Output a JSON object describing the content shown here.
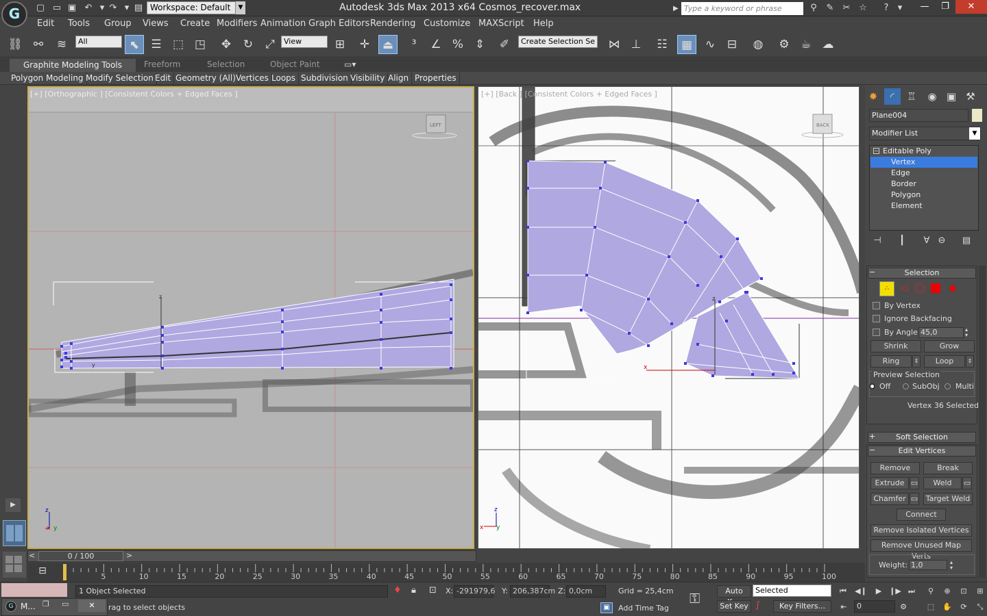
{
  "titlebar": {
    "app_title": "Autodesk 3ds Max  2013 x64     Cosmos_recover.max",
    "workspace": "Workspace: Default",
    "search_placeholder": "Type a keyword or phrase",
    "app_icon": "3ds-max-logo"
  },
  "menu": [
    "Edit",
    "Tools",
    "Group",
    "Views",
    "Create",
    "Modifiers",
    "Animation",
    "Graph Editors",
    "Rendering",
    "Customize",
    "MAXScript",
    "Help"
  ],
  "toolbar": {
    "selection_filter": "All",
    "ref_coord": "View",
    "named_selection": "Create Selection Se"
  },
  "ribbon": {
    "tabs": [
      "Graphite Modeling Tools",
      "Freeform",
      "Selection",
      "Object Paint"
    ],
    "subtabs": [
      "Polygon Modeling",
      "Modify Selection",
      "Edit",
      "Geometry (All)",
      "Vertices",
      "Loops",
      "Subdivision",
      "Visibility",
      "Align",
      "Properties"
    ]
  },
  "viewports": {
    "left_label": "[+] [Orthographic ] [Consistent Colors + Edged Faces ]",
    "left_cube": "LEFT",
    "right_label": "[+] [Back ] [Consistent Colors + Edged Faces ]",
    "right_cube": "BACK"
  },
  "command_panel": {
    "object_name": "Plane004",
    "modifier_list": "Modifier List",
    "stack": [
      "Editable Poly",
      "Vertex",
      "Edge",
      "Border",
      "Polygon",
      "Element"
    ],
    "selection": {
      "header": "Selection",
      "by_vertex": "By Vertex",
      "ignore_backfacing": "Ignore Backfacing",
      "by_angle": "By Angle:",
      "angle_value": "45,0",
      "shrink": "Shrink",
      "grow": "Grow",
      "ring": "Ring",
      "loop": "Loop",
      "preview": "Preview Selection",
      "off": "Off",
      "subobj": "SubObj",
      "multi": "Multi",
      "status": "Vertex 36 Selected"
    },
    "soft_selection": "Soft Selection",
    "edit_vertices": {
      "header": "Edit Vertices",
      "remove": "Remove",
      "break": "Break",
      "extrude": "Extrude",
      "weld": "Weld",
      "chamfer": "Chamfer",
      "target_weld": "Target Weld",
      "connect": "Connect",
      "remove_isolated": "Remove Isolated Vertices",
      "remove_unused": "Remove Unused Map Verts",
      "weight_label": "Weight:",
      "weight_value": "1,0"
    }
  },
  "timeline": {
    "frame": "0 / 100",
    "ticks": [
      "5",
      "10",
      "15",
      "20",
      "25",
      "30",
      "35",
      "40",
      "45",
      "50",
      "55",
      "60",
      "65",
      "70",
      "75",
      "80",
      "85",
      "90",
      "95",
      "100"
    ]
  },
  "status": {
    "selected": "1 Object Selected",
    "prompt": "ck-and-drag to select objects",
    "x_label": "X:",
    "x": "-291979,6",
    "y_label": "Y:",
    "y": "206,387cm",
    "z_label": "Z:",
    "z": "0,0cm",
    "grid": "Grid = 25,4cm",
    "add_time_tag": "Add Time Tag",
    "auto_key": "Auto Key",
    "set_key": "Set Key",
    "selected_mode": "Selected",
    "key_filters": "Key Filters...",
    "frame_value": "0"
  },
  "taskbar": {
    "app": "M..."
  }
}
